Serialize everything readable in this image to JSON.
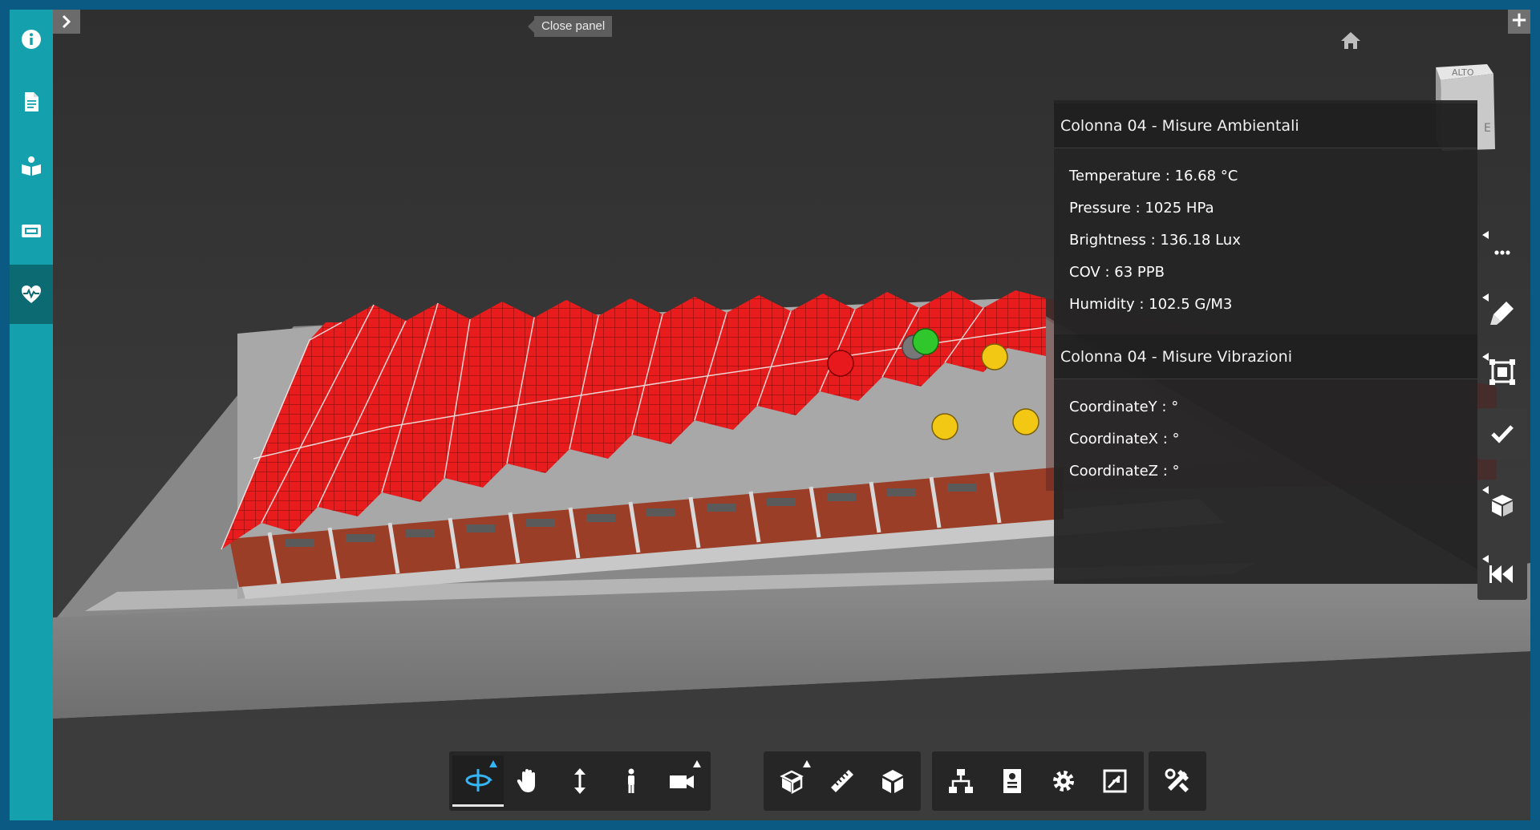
{
  "sidebar": {
    "items": [
      {
        "icon": "info-icon"
      },
      {
        "icon": "document-icon"
      },
      {
        "icon": "reading-person-icon"
      },
      {
        "icon": "ticket-icon"
      },
      {
        "icon": "heart-pulse-icon",
        "active": true
      }
    ],
    "accent": "#14a1ad",
    "active_color": "#0c6b72"
  },
  "viewer": {
    "close_panel_label": "Close panel",
    "plus_label": "+",
    "view_cube_labels": {
      "top": "ALTO",
      "side": "E"
    }
  },
  "info_panel": {
    "sections": [
      {
        "title": "Colonna 04 - Misure Ambientali",
        "rows": [
          {
            "label": "Temperature : ",
            "value": "16.68 °C"
          },
          {
            "label": "Pressure : ",
            "value": "1025 HPa"
          },
          {
            "label": "Brightness : ",
            "value": "136.18 Lux"
          },
          {
            "label": "COV : ",
            "value": "63 PPB"
          },
          {
            "label": "Humidity : ",
            "value": "102.5 G/M3"
          }
        ]
      },
      {
        "title": "Colonna 04 - Misure Vibrazioni",
        "rows": [
          {
            "label": "CoordinateY : ",
            "value": "°"
          },
          {
            "label": "CoordinateX : ",
            "value": "°"
          },
          {
            "label": "CoordinateZ : ",
            "value": "°"
          }
        ]
      }
    ]
  },
  "sensor_markers": [
    {
      "color": "#e8191c",
      "status": "red"
    },
    {
      "color": "#777777",
      "status": "grey"
    },
    {
      "color": "#2fc72c",
      "status": "green"
    },
    {
      "color": "#f2c814",
      "status": "yellow"
    },
    {
      "color": "#f2c814",
      "status": "yellow"
    },
    {
      "color": "#f2c814",
      "status": "yellow"
    }
  ],
  "right_toolbar": [
    "more-icon",
    "highlighter-icon",
    "section-box-icon",
    "checkmark-icon",
    "cube-add-icon",
    "rewind-icon"
  ],
  "bottom_toolbar": {
    "groups": [
      [
        "orbit-icon",
        "pan-icon",
        "zoom-icon",
        "first-person-icon",
        "camera-icon"
      ],
      [
        "explode-model-icon",
        "measure-icon",
        "section-icon"
      ],
      [
        "model-browser-icon",
        "properties-icon",
        "settings-icon",
        "fullscreen-icon"
      ],
      [
        "tools-icon"
      ]
    ]
  },
  "colors": {
    "roof": "#e81c1c",
    "wall": "#9a3e28",
    "ground": "#9c9c9c",
    "background": "#2c2c2c",
    "frame": "#0a5a84"
  }
}
